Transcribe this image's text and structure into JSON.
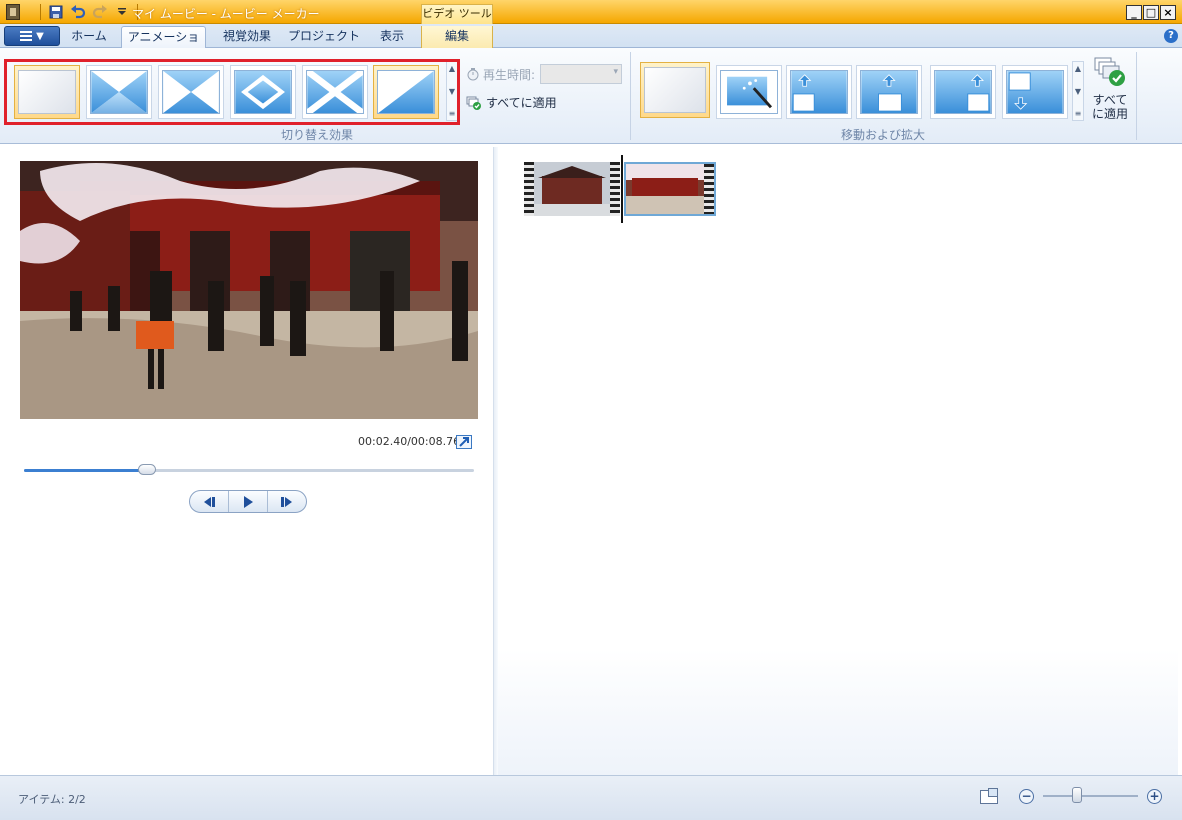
{
  "titlebar": {
    "title": "マイ ムービー - ムービー メーカー",
    "context_tab_title": "ビデオ ツール"
  },
  "window_buttons": {
    "minimize": "_",
    "maximize": "□",
    "close": "×"
  },
  "tabs": [
    {
      "label": "ホーム"
    },
    {
      "label": "アニメーション"
    },
    {
      "label": "視覚効果"
    },
    {
      "label": "プロジェクト"
    },
    {
      "label": "表示"
    },
    {
      "label": "編集"
    }
  ],
  "active_tab": "アニメーション",
  "ribbon": {
    "transitions": {
      "group_label": "切り替え効果",
      "duration_label": "再生時間:",
      "duration_value": "",
      "apply_all_label": "すべてに適用",
      "items": [
        "none",
        "diagonal-cross",
        "bow-tie-horizontal",
        "diamond",
        "diagonal-x",
        "diagonal-wipe"
      ],
      "selected_index": 0
    },
    "pan_zoom": {
      "group_label": "移動および拡大",
      "apply_all_label_1": "すべて",
      "apply_all_label_2": "に適用",
      "items": [
        "none",
        "automatic",
        "pan-up-left",
        "pan-up-center",
        "pan-up-right",
        "pan-down-left"
      ],
      "selected_index": 0
    }
  },
  "preview": {
    "time": "00:02.40/00:08.76",
    "seek_progress": 0.274
  },
  "storyboard": {
    "clips": [
      "temple-gate-clip",
      "cherry-blossom-clip"
    ]
  },
  "status": {
    "items": "アイテム: 2/2",
    "zoom_level": 0.36
  },
  "colors": {
    "title_bar": "#f5a700",
    "accent": "#3b7fd1",
    "highlight_frame": "#e0212b"
  }
}
